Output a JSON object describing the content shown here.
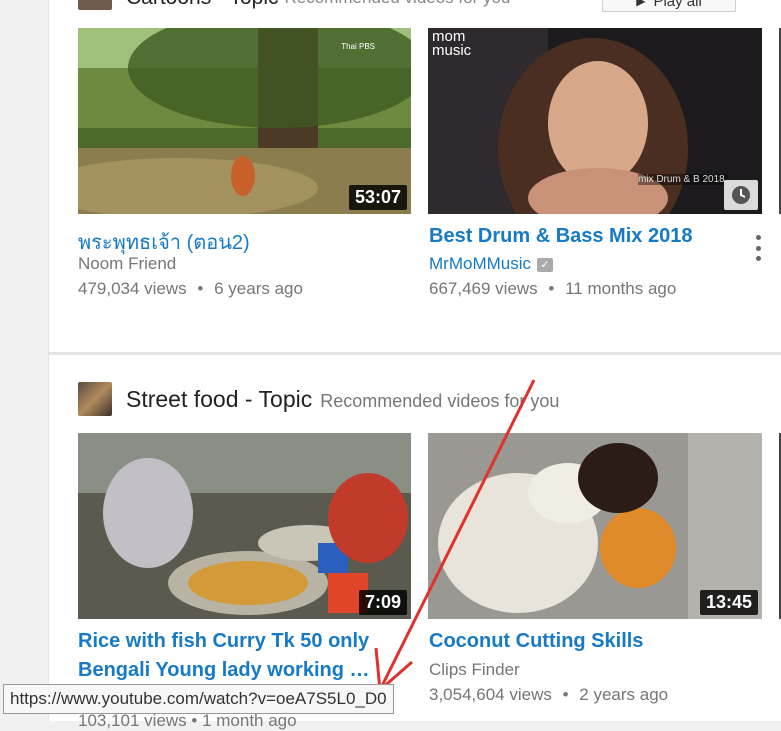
{
  "top_section": {
    "title": "Cartoons - Topic",
    "subtitle": "Recommended videos for you",
    "play_all_label": "Play all"
  },
  "top_videos": [
    {
      "title": "พระพุทธเจ้า (ตอน2)",
      "channel": "Noom Friend",
      "views": "479,034 views",
      "age": "6 years ago",
      "duration": "53:07",
      "watermark": "Thai PBS"
    },
    {
      "title": "Best Drum & Bass Mix 2018",
      "channel": "MrMoMMusic",
      "views": "667,469 views",
      "age": "11 months ago",
      "logo_text": "mom music",
      "overlay_text": "mix Drum & B 2018"
    }
  ],
  "street_section": {
    "title": "Street food - Topic",
    "subtitle": "Recommended videos for you"
  },
  "street_videos": [
    {
      "title_line1": "Rice with fish Curry Tk 50 only",
      "title_line2": "Bengali Young lady working …",
      "duration": "7:09",
      "partial_meta": "103,101 views • 1 month ago"
    },
    {
      "title": "Coconut Cutting Skills",
      "channel": "Clips Finder",
      "views": "3,054,604 views",
      "age": "2 years ago",
      "duration": "13:45"
    }
  ],
  "meta_separator": "•",
  "status_url": "https://www.youtube.com/watch?v=oeA7S5L0_D0",
  "colors": {
    "link_blue": "#167ac6",
    "annotation_arrow": "#e0312c"
  },
  "icons": [
    "watch-later-icon",
    "verified-icon",
    "more-vert-icon",
    "play-all-icon"
  ]
}
